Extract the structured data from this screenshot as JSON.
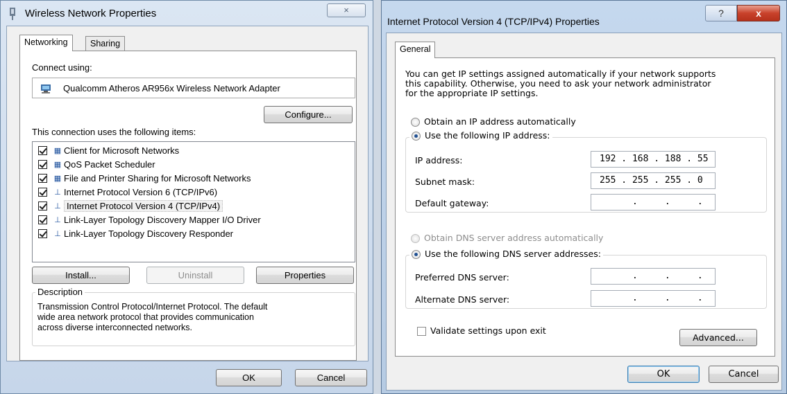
{
  "left_window": {
    "title": "Wireless Network Properties",
    "close_label": "×",
    "tabs": [
      "Networking",
      "Sharing"
    ],
    "connect_using_label": "Connect using:",
    "adapter_name": "Qualcomm Atheros AR956x Wireless Network Adapter",
    "configure_label": "Configure...",
    "items_label": "This connection uses the following items:",
    "items": [
      {
        "label": "Client for Microsoft Networks",
        "checked": true
      },
      {
        "label": "QoS Packet Scheduler",
        "checked": true
      },
      {
        "label": "File and Printer Sharing for Microsoft Networks",
        "checked": true
      },
      {
        "label": "Internet Protocol Version 6 (TCP/IPv6)",
        "checked": true
      },
      {
        "label": "Internet Protocol Version 4 (TCP/IPv4)",
        "checked": true
      },
      {
        "label": "Link-Layer Topology Discovery Mapper I/O Driver",
        "checked": true
      },
      {
        "label": "Link-Layer Topology Discovery Responder",
        "checked": true
      }
    ],
    "install_label": "Install...",
    "uninstall_label": "Uninstall",
    "properties_label": "Properties",
    "description_legend": "Description",
    "description_text": [
      "Transmission Control Protocol/Internet Protocol. The default",
      "wide area network protocol that provides communication",
      "across diverse interconnected networks."
    ],
    "ok_label": "OK",
    "cancel_label": "Cancel"
  },
  "right_window": {
    "title": "Internet Protocol Version 4 (TCP/IPv4) Properties",
    "help_label": "?",
    "close_label": "x",
    "tab": "General",
    "intro_lines": [
      "You can get IP settings assigned automatically if your network supports",
      "this capability. Otherwise, you need to ask your network administrator",
      "for the appropriate IP settings."
    ],
    "obtain_ip_auto": "Obtain an IP address automatically",
    "use_following_ip": "Use the following IP address:",
    "ip_address_label": "IP address:",
    "ip_address_value": "192 . 168 . 188 . 55",
    "subnet_mask_label": "Subnet mask:",
    "subnet_mask_value": "255 . 255 . 255 . 0",
    "default_gateway_label": "Default gateway:",
    "default_gateway_value": "      .     .     .",
    "obtain_dns_auto": "Obtain DNS server address automatically",
    "use_following_dns": "Use the following DNS server addresses:",
    "preferred_dns_label": "Preferred DNS server:",
    "preferred_dns_value": "      .     .     .",
    "alternate_dns_label": "Alternate DNS server:",
    "alternate_dns_value": "      .     .     .",
    "validate_label": "Validate settings upon exit",
    "advanced_label": "Advanced...",
    "ok_label": "OK",
    "cancel_label": "Cancel"
  }
}
